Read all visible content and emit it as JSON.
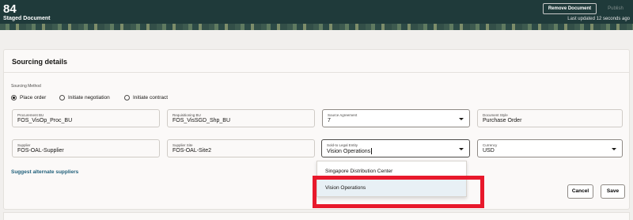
{
  "header": {
    "doc_number": "84",
    "doc_status": "Staged Document",
    "remove_label": "Remove Document",
    "publish_label": "Publish",
    "last_updated": "Last updated 12 seconds ago"
  },
  "sourcing": {
    "title": "Sourcing details",
    "method_label": "Sourcing Method",
    "methods": [
      {
        "label": "Place order",
        "selected": true
      },
      {
        "label": "Initiate negotiation",
        "selected": false
      },
      {
        "label": "Initiate contract",
        "selected": false
      }
    ],
    "fields": {
      "procurement_bu": {
        "label": "Procurement BU",
        "value": "FOS_VisOp_Proc_BU"
      },
      "requisitioning_bu": {
        "label": "Requisitioning BU",
        "value": "FOS_VisSGD_Shp_BU"
      },
      "source_agreement": {
        "label": "Source Agreement",
        "value": "7"
      },
      "document_style": {
        "label": "Document Style",
        "value": "Purchase Order"
      },
      "supplier": {
        "label": "Supplier",
        "value": "FOS-OAL-Supplier"
      },
      "supplier_site": {
        "label": "Supplier Site",
        "value": "FOS-OAL-Site2"
      },
      "sold_to_legal_entity": {
        "label": "Sold-to Legal Entity",
        "value": "Vision Operations"
      },
      "currency": {
        "label": "Currency",
        "value": "USD"
      }
    },
    "suggest_link": "Suggest alternate suppliers",
    "dropdown_options": [
      "Singapore Distribution Center",
      "Vision Operations"
    ],
    "cancel_label": "Cancel",
    "save_label": "Save"
  }
}
